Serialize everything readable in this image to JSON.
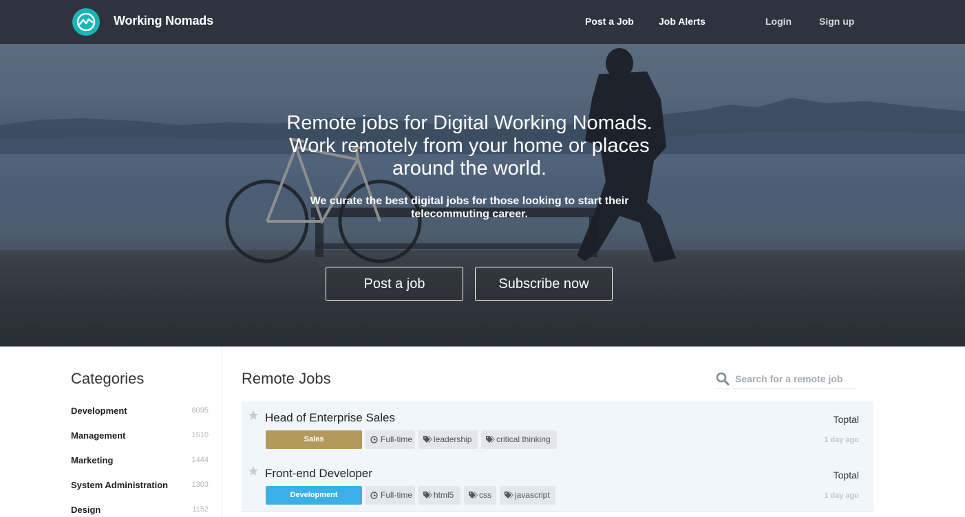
{
  "header": {
    "brand": "Working Nomads",
    "nav": {
      "post_a_job": "Post a Job",
      "job_alerts": "Job Alerts",
      "login": "Login",
      "sign_up": "Sign up"
    },
    "logo_icon": "trend-chart-icon",
    "accent_color": "#18b5b6"
  },
  "hero": {
    "title_line1": "Remote jobs for Digital Working Nomads.",
    "title_line2": "Work remotely from your home or places",
    "title_line3": "around the world.",
    "subtitle_line1": "We curate the best digital jobs for those looking to start their",
    "subtitle_line2": "telecommuting career.",
    "post_job_button": "Post a job",
    "subscribe_button": "Subscribe now"
  },
  "sidebar": {
    "title": "Categories",
    "categories": [
      {
        "label": "Development",
        "count": "8095"
      },
      {
        "label": "Management",
        "count": "1510"
      },
      {
        "label": "Marketing",
        "count": "1444"
      },
      {
        "label": "System Administration",
        "count": "1303"
      },
      {
        "label": "Design",
        "count": "1152"
      }
    ]
  },
  "main": {
    "title": "Remote Jobs",
    "search_placeholder": "Search for a remote job",
    "jobs": [
      {
        "title": "Head of Enterprise Sales",
        "company": "Toptal",
        "posted": "1 day ago",
        "category": "Sales",
        "category_color": "#b39a5b",
        "type": "Full-time",
        "tags": [
          "leadership",
          "critical thinking"
        ]
      },
      {
        "title": "Front-end Developer",
        "company": "Toptal",
        "posted": "1 day ago",
        "category": "Development",
        "category_color": "#3bb0e8",
        "type": "Full-time",
        "tags": [
          "html5",
          "css",
          "javascript"
        ]
      }
    ]
  }
}
